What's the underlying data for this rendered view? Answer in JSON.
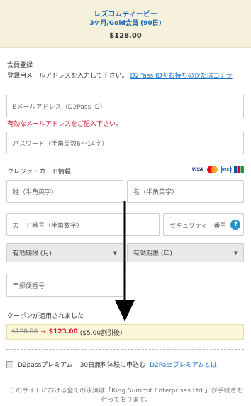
{
  "header": {
    "site_name": "レズコムティービー",
    "plan": "3ケ月/Gold会員 (90日)",
    "price": "$128.00"
  },
  "registration": {
    "title": "会員登録",
    "intro_text": "登録用メールアドレスを入力して下さい。",
    "intro_link": "D2Pass IDをお持ちのかたはコチラ",
    "email_placeholder": "Eメールアドレス（D2Pass ID）",
    "email_error": "有効なメールアドレスをご記入下さい。",
    "password_placeholder": "パスワード（半角英数6〜14字）"
  },
  "credit_card": {
    "title": "クレジットカード情報",
    "logos": [
      "VISA",
      "MC",
      "AMEX",
      "JCB"
    ],
    "last_name_placeholder": "姓（半角英字）",
    "first_name_placeholder": "名（半角英字）",
    "card_number_placeholder": "カード番号（半角数字）",
    "security_code_placeholder": "セキュリティー番号",
    "help_icon": "?",
    "exp_month": "有効期限 (月)",
    "exp_year": "有効期限 (年)",
    "postal_placeholder": "〒郵便番号"
  },
  "coupon": {
    "applied_text": "クーポンが適用されました",
    "old_price": "$128.00",
    "arrow": "→",
    "new_price": "$123.00",
    "discount": "($5.00割引後)"
  },
  "premium": {
    "label": "D2passプレミアム",
    "trial": "30日無料体験に申込む",
    "link": "D2Passプレミアムとは"
  },
  "footer": {
    "text": "このサイトにおける全ての決済は「King Summit Enterprises Ltd.」が手続きを行っております。"
  },
  "colors": {
    "header_bg": "#f6f1dc",
    "link": "#1a73c8",
    "error": "#c8102e",
    "coupon_bg": "#fbf6d8"
  }
}
